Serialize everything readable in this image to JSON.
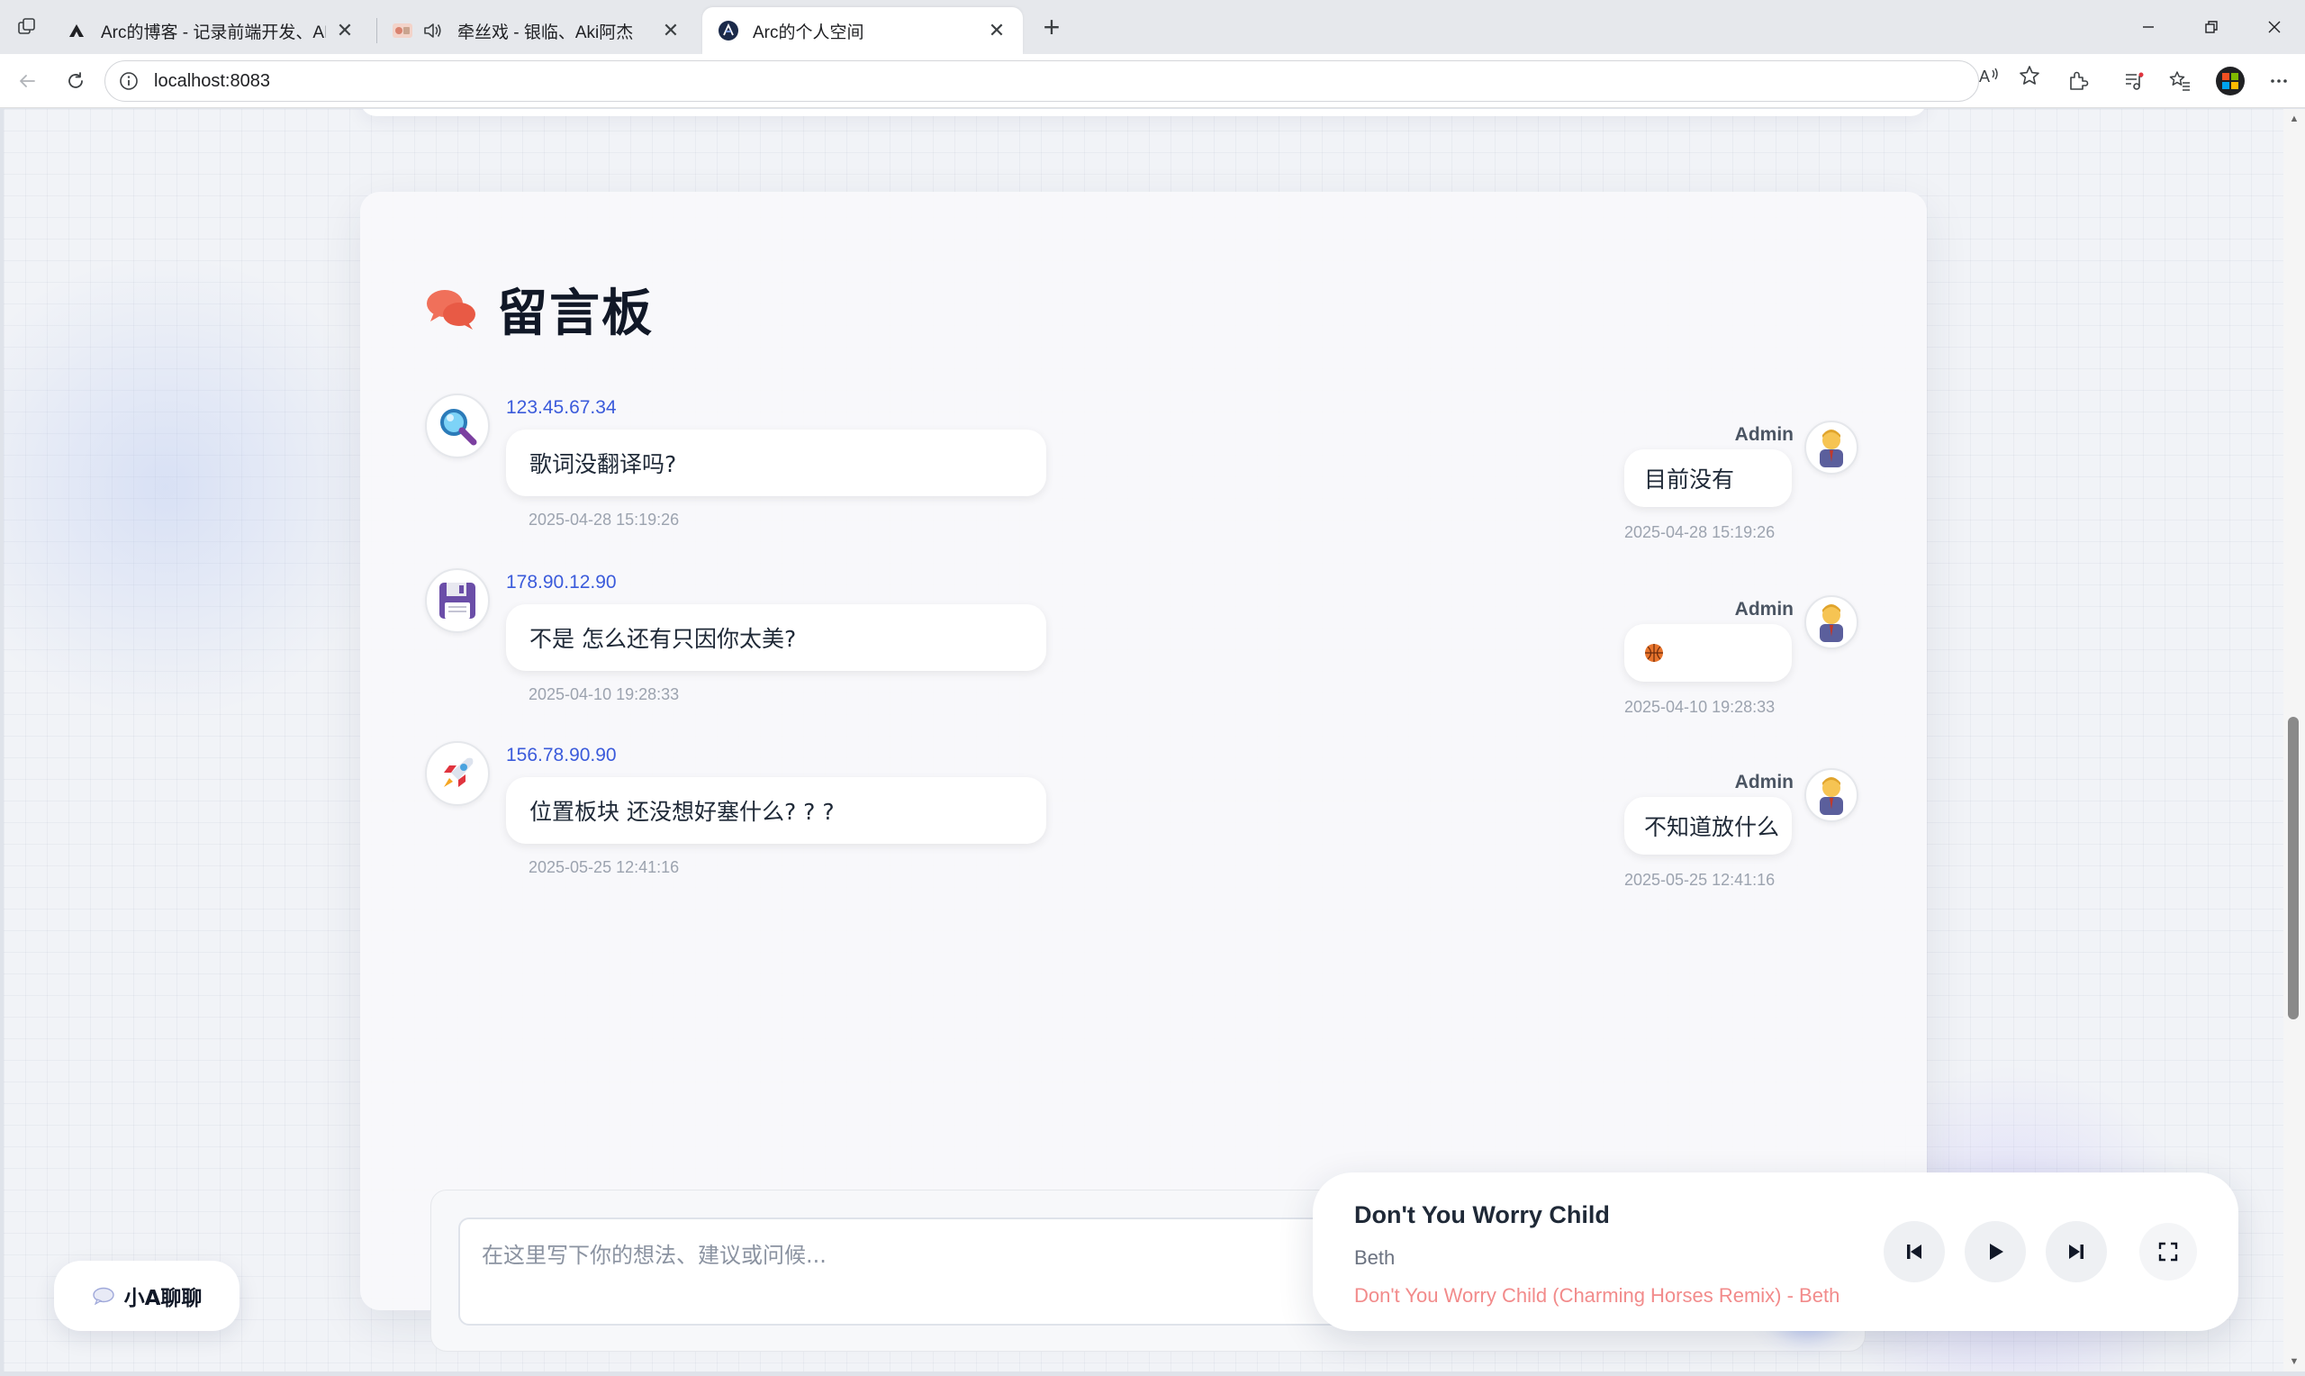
{
  "browser": {
    "tabs": [
      {
        "title": "Arc的博客 - 记录前端开发、AI探索",
        "active": false
      },
      {
        "title": "牵丝戏 - 银临、Aki阿杰",
        "active": false,
        "audio": true
      },
      {
        "title": "Arc的个人空间",
        "active": true
      }
    ],
    "address": "localhost:8083"
  },
  "guestbook": {
    "title": "留言板",
    "messages": [
      {
        "ip": "123.45.67.34",
        "avatar_icon": "magnifying-glass-icon",
        "text": "歌词没翻译吗?",
        "time": "2025-04-28 15:19:26",
        "reply": {
          "name": "Admin",
          "text": "目前没有",
          "time": "2025-04-28 15:19:26"
        }
      },
      {
        "ip": "178.90.12.90",
        "avatar_icon": "floppy-disk-icon",
        "text": "不是 怎么还有只因你太美?",
        "time": "2025-04-10 19:28:33",
        "reply": {
          "name": "Admin",
          "text": "🏀",
          "time": "2025-04-10 19:28:33"
        }
      },
      {
        "ip": "156.78.90.90",
        "avatar_icon": "rocket-icon",
        "text": "位置板块 还没想好塞什么? ? ?",
        "time": "2025-05-25 12:41:16",
        "reply": {
          "name": "Admin",
          "text": "不知道放什么",
          "time": "2025-05-25 12:41:16"
        }
      }
    ],
    "composer_placeholder": "在这里写下你的想法、建议或问候..."
  },
  "chat_widget": {
    "label": "小A聊聊"
  },
  "player": {
    "song": "Don't You Worry Child",
    "artist": "Beth",
    "lyric": "Don't You Worry Child (Charming Horses Remix) - Beth"
  },
  "colors": {
    "accent": "#3b63f0",
    "ip_link": "#3b5bdb",
    "lyric": "#f28b8b",
    "title_icon": "#f0705a"
  }
}
